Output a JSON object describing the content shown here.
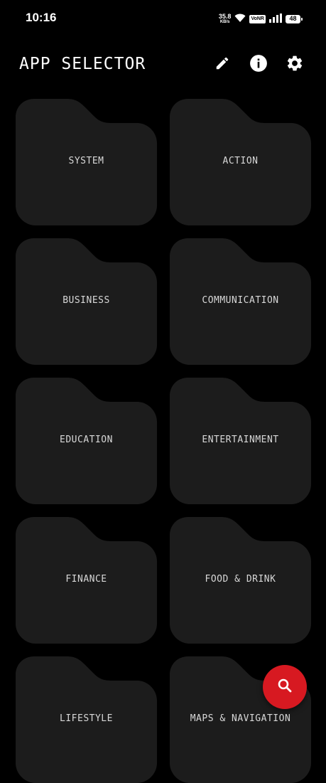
{
  "status_bar": {
    "time": "10:16",
    "net_speed_value": "35.8",
    "net_speed_unit": "KB/s",
    "vonr_label": "VoNR",
    "battery_level": "48",
    "icons": [
      "wifi-icon",
      "signal-icon",
      "battery-icon"
    ]
  },
  "app_bar": {
    "title": "APP SELECTOR",
    "actions": [
      "edit-icon",
      "info-icon",
      "settings-icon"
    ]
  },
  "categories": [
    {
      "label": "SYSTEM"
    },
    {
      "label": "ACTION"
    },
    {
      "label": "BUSINESS"
    },
    {
      "label": "COMMUNICATION"
    },
    {
      "label": "EDUCATION"
    },
    {
      "label": "ENTERTAINMENT"
    },
    {
      "label": "FINANCE"
    },
    {
      "label": "FOOD & DRINK"
    },
    {
      "label": "LIFESTYLE"
    },
    {
      "label": "MAPS & NAVIGATION"
    }
  ],
  "fab": {
    "icon": "search-icon"
  },
  "colors": {
    "background": "#000000",
    "folder": "#1c1c1c",
    "accent": "#d71921",
    "text": "#ffffff"
  }
}
